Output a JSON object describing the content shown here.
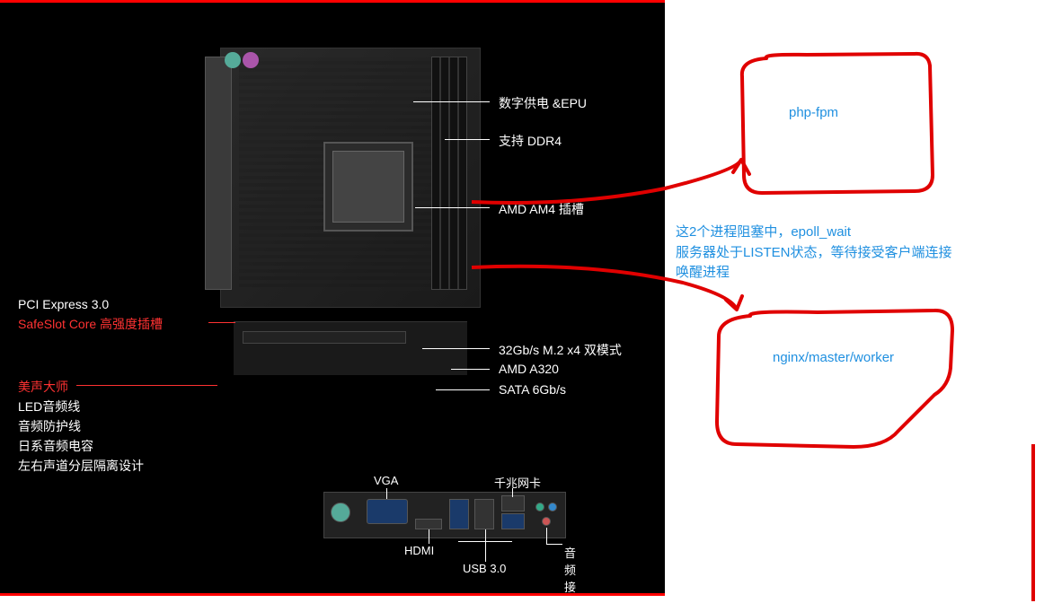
{
  "motherboard": {
    "right_labels": {
      "epu": "数字供电 &EPU",
      "ddr4": "支持 DDR4",
      "am4": "AMD AM4 插槽",
      "m2": "32Gb/s M.2 x4 双模式",
      "a320": "AMD A320",
      "sata": "SATA 6Gb/s"
    },
    "left_labels": {
      "pcie": "PCI Express 3.0",
      "safeslot": "SafeSlot Core 高强度插槽",
      "audio_title": "美声大师",
      "audio_1": "LED音频线",
      "audio_2": "音频防护线",
      "audio_3": "日系音频电容",
      "audio_4": "左右声道分层隔离设计"
    },
    "io_labels": {
      "vga": "VGA",
      "lan": "千兆网卡",
      "hdmi": "HDMI",
      "usb3": "USB 3.0",
      "audio": "音频接口"
    }
  },
  "annotations": {
    "box1": "php-fpm",
    "note_line1": "这2个进程阻塞中，epoll_wait",
    "note_line2": "服务器处于LISTEN状态，等待接受客户端连接",
    "note_line3": "唤醒进程",
    "box2": "nginx/master/worker"
  }
}
